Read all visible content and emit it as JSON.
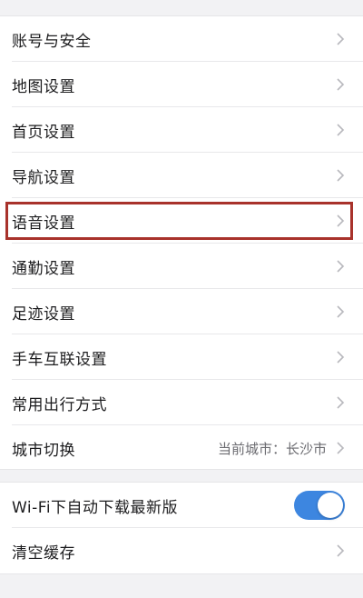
{
  "settings_group": {
    "items": [
      {
        "label": "账号与安全"
      },
      {
        "label": "地图设置"
      },
      {
        "label": "首页设置"
      },
      {
        "label": "导航设置"
      },
      {
        "label": "语音设置"
      },
      {
        "label": "通勤设置"
      },
      {
        "label": "足迹设置"
      },
      {
        "label": "手车互联设置"
      },
      {
        "label": "常用出行方式"
      },
      {
        "label": "城市切换",
        "value": "当前城市：长沙市"
      }
    ]
  },
  "storage_group": {
    "wifi_download": {
      "label": "Wi-Fi下自动下载最新版",
      "enabled": true
    },
    "clear_cache": {
      "label": "清空缓存"
    }
  },
  "colors": {
    "accent": "#3d86e0",
    "highlight_border": "#a8322b",
    "background": "#f2f2f4"
  },
  "icons": {
    "row_arrow": "chevron-right-icon"
  }
}
